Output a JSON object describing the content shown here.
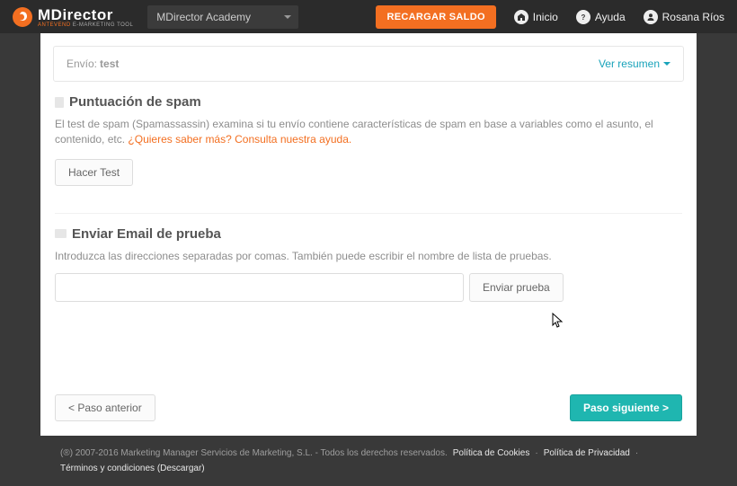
{
  "topbar": {
    "brand": "MDirector",
    "brand_sub_orange": "ANTEVEND",
    "brand_sub_gray": " E-MARKETING TOOL",
    "account": "MDirector Academy",
    "recargar": "RECARGAR SALDO",
    "inicio": "Inicio",
    "ayuda": "Ayuda",
    "user": "Rosana Ríos"
  },
  "envio": {
    "label": "Envío:",
    "value": "test",
    "ver_resumen": "Ver resumen"
  },
  "spam": {
    "title": "Puntuación de spam",
    "desc": "El test de spam (Spamassassin) examina si tu envío contiene características de spam en base a variables como el asunto, el contenido, etc.",
    "help": "¿Quieres saber más? Consulta nuestra ayuda.",
    "button": "Hacer Test"
  },
  "prueba": {
    "title": "Enviar Email de prueba",
    "desc": "Introduzca las direcciones separadas por comas. También puede escribir el nombre de lista de pruebas.",
    "button": "Enviar prueba"
  },
  "wizard": {
    "prev": "< Paso anterior",
    "next": "Paso siguiente >"
  },
  "footer": {
    "copyright": "(®) 2007-2016 Marketing Manager Servicios de Marketing, S.L. - Todos los derechos reservados.",
    "cookies": "Política de Cookies",
    "privacy": "Política de Privacidad",
    "terms": "Términos y condiciones (Descargar)"
  }
}
